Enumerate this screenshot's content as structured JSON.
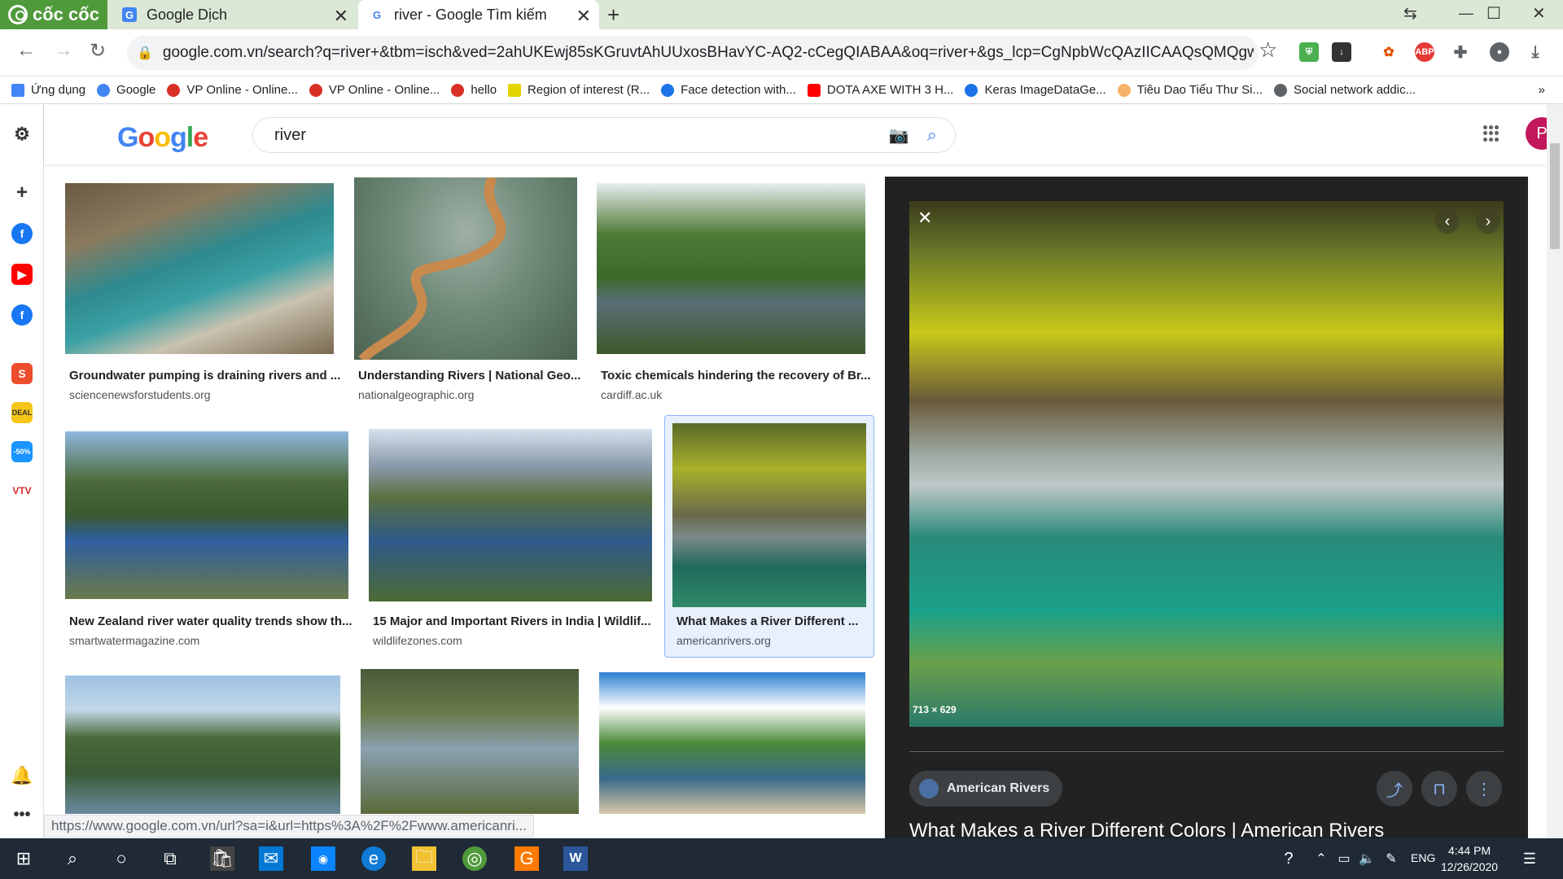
{
  "browser": {
    "logo_text": "cốc cốc",
    "tabs": [
      {
        "title": "Google Dịch",
        "icon": "google-translate-icon"
      },
      {
        "title": "river - Google Tìm kiếm",
        "icon": "google-g-icon",
        "active": true
      }
    ],
    "url": "google.com.vn/search?q=river+&tbm=isch&ved=2ahUKEwj85sKGruvtAhUUxosBHavYC-AQ2-cCegQIABAA&oq=river+&gs_lcp=CgNpbWcQAzIICAAQsQMQgwEyAggAMg...",
    "bookmarks": [
      {
        "label": "Ứng dụng",
        "color": "#4285f4"
      },
      {
        "label": "Google",
        "color": "#4285f4"
      },
      {
        "label": "VP Online - Online...",
        "color": "#d93025"
      },
      {
        "label": "VP Online - Online...",
        "color": "#d93025"
      },
      {
        "label": "hello",
        "color": "#d93025"
      },
      {
        "label": "Region of interest (R...",
        "color": "#e3d400"
      },
      {
        "label": "Face detection with...",
        "color": "#1a73e8"
      },
      {
        "label": "DOTA AXE WITH 3 H...",
        "color": "#ff0000"
      },
      {
        "label": "Keras ImageDataGe...",
        "color": "#1a73e8"
      },
      {
        "label": "Tiêu Dao Tiểu Thư Si...",
        "color": "#f6b26b"
      },
      {
        "label": "Social network addic...",
        "color": "#5f6368"
      }
    ],
    "bookmarks_more": "»",
    "status_url": "https://www.google.com.vn/url?sa=i&url=https%3A%2F%2Fwww.americanri..."
  },
  "google": {
    "search_query": "river",
    "avatar_letter": "P",
    "results": [
      {
        "title": "Groundwater pumping is draining rivers and ...",
        "source": "sciencenewsforstudents.org"
      },
      {
        "title": "Understanding Rivers | National Geo...",
        "source": "nationalgeographic.org"
      },
      {
        "title": "Toxic chemicals hindering the recovery of Br...",
        "source": "cardiff.ac.uk"
      },
      {
        "title": "New Zealand river water quality trends show th...",
        "source": "smartwatermagazine.com"
      },
      {
        "title": "15 Major and Important Rivers in India | Wildlif...",
        "source": "wildlifezones.com"
      },
      {
        "title": "What Makes a River Different ...",
        "source": "americanrivers.org"
      }
    ],
    "preview": {
      "dimensions": "713 × 629",
      "source_name": "American Rivers",
      "title": "What Makes a River Different Colors | American Rivers"
    }
  },
  "taskbar": {
    "language": "ENG",
    "time": "4:44 PM",
    "date": "12/26/2020"
  }
}
